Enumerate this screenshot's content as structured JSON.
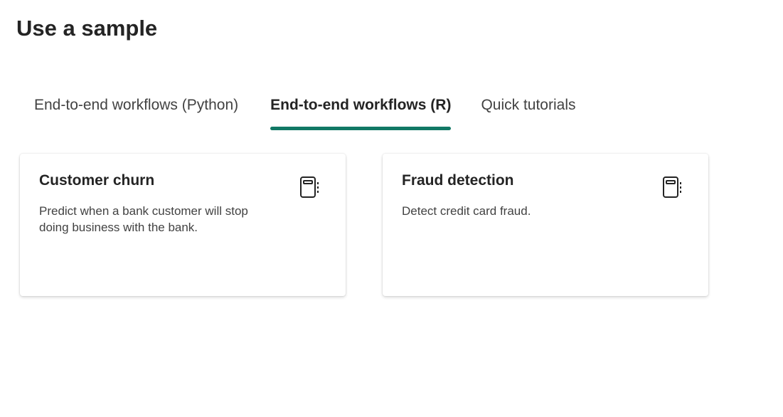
{
  "page": {
    "title": "Use a sample"
  },
  "tabs": [
    {
      "label": "End-to-end workflows (Python)",
      "active": false
    },
    {
      "label": "End-to-end workflows (R)",
      "active": true
    },
    {
      "label": "Quick tutorials",
      "active": false
    }
  ],
  "cards": [
    {
      "title": "Customer churn",
      "description": "Predict when a bank customer will stop doing business with the bank.",
      "icon": "notebook-icon"
    },
    {
      "title": "Fraud detection",
      "description": "Detect credit card fraud.",
      "icon": "notebook-icon"
    }
  ],
  "colors": {
    "accent": "#117865",
    "text_primary": "#242424",
    "text_secondary": "#424242"
  }
}
